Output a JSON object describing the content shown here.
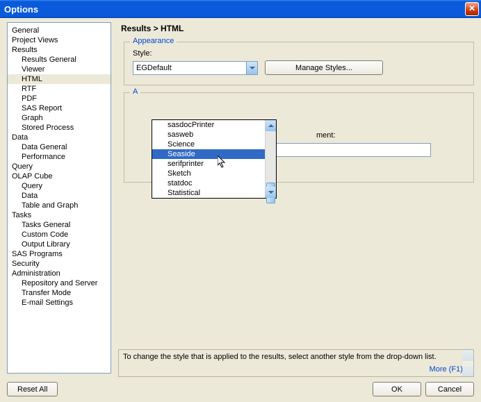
{
  "title": "Options",
  "breadcrumb": "Results > HTML",
  "tree": {
    "items": [
      {
        "label": "General",
        "indent": false
      },
      {
        "label": "Project Views",
        "indent": false
      },
      {
        "label": "Results",
        "indent": false
      },
      {
        "label": "Results General",
        "indent": true
      },
      {
        "label": "Viewer",
        "indent": true
      },
      {
        "label": "HTML",
        "indent": true,
        "selected": true
      },
      {
        "label": "RTF",
        "indent": true
      },
      {
        "label": "PDF",
        "indent": true
      },
      {
        "label": "SAS Report",
        "indent": true
      },
      {
        "label": "Graph",
        "indent": true
      },
      {
        "label": "Stored Process",
        "indent": true
      },
      {
        "label": "Data",
        "indent": false
      },
      {
        "label": "Data General",
        "indent": true
      },
      {
        "label": "Performance",
        "indent": true
      },
      {
        "label": "Query",
        "indent": false
      },
      {
        "label": "OLAP Cube",
        "indent": false
      },
      {
        "label": "Query",
        "indent": true
      },
      {
        "label": "Data",
        "indent": true
      },
      {
        "label": "Table and Graph",
        "indent": true
      },
      {
        "label": "Tasks",
        "indent": false
      },
      {
        "label": "Tasks General",
        "indent": true
      },
      {
        "label": "Custom Code",
        "indent": true
      },
      {
        "label": "Output Library",
        "indent": true
      },
      {
        "label": "SAS Programs",
        "indent": false
      },
      {
        "label": "Security",
        "indent": false
      },
      {
        "label": "Administration",
        "indent": false
      },
      {
        "label": "Repository and Server",
        "indent": true
      },
      {
        "label": "Transfer Mode",
        "indent": true
      },
      {
        "label": "E-mail Settings",
        "indent": true
      }
    ]
  },
  "appearance": {
    "group_title": "Appearance",
    "style_label": "Style:",
    "style_selected": "EGDefault",
    "manage_styles": "Manage Styles...",
    "dropdown_items": [
      {
        "label": "sasdocPrinter"
      },
      {
        "label": "sasweb"
      },
      {
        "label": "Science"
      },
      {
        "label": "Seaside",
        "highlight": true
      },
      {
        "label": "serifprinter"
      },
      {
        "label": "Sketch"
      },
      {
        "label": "statdoc"
      },
      {
        "label": "Statistical"
      }
    ]
  },
  "addl": {
    "group_title_partial": "A",
    "fragment_label": "ment:"
  },
  "help": {
    "text": "To change the style that is applied to the results, select another style from the drop-down list.",
    "more": "More (F1)..."
  },
  "buttons": {
    "reset_all": "Reset All",
    "ok": "OK",
    "cancel": "Cancel"
  }
}
